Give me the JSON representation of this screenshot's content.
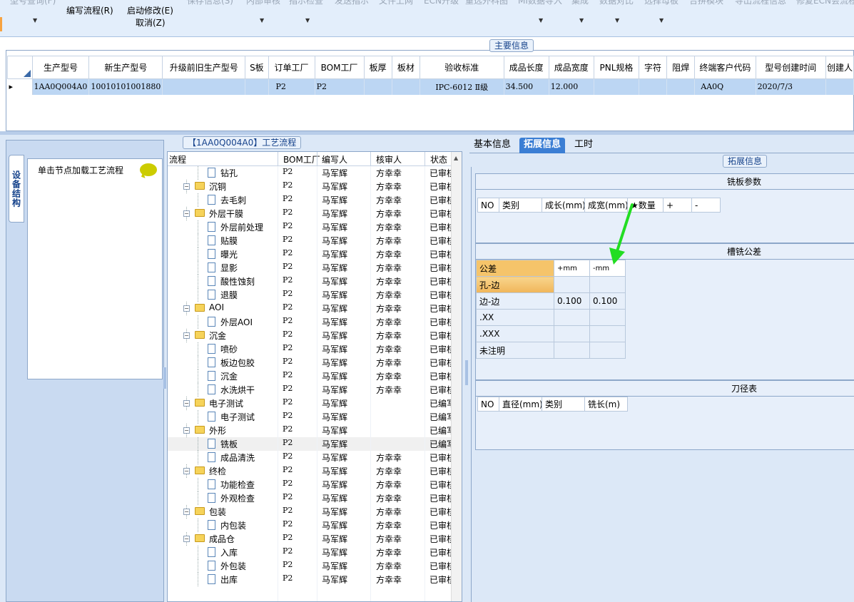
{
  "toolbar": {
    "top_row": [
      "型号查询(F)",
      "保存信息(S)",
      "内部审核",
      "指示检查",
      "发送指示",
      "文件上网",
      "ECN升级",
      "重选外科图",
      "MI数据导入",
      "集成",
      "数据对比",
      "选择母板",
      "合拼模块",
      "导出流程信息",
      "修复ECN会流程"
    ],
    "edit_flow": "编写流程(R)",
    "start_modify": "启动修改(E)",
    "cancel": "取消(Z)"
  },
  "main_group": {
    "title": "主要信息",
    "columns": [
      "生产型号",
      "新生产型号",
      "升级前旧生产型号",
      "S板",
      "订单工厂",
      "BOM工厂",
      "板厚",
      "板材",
      "验收标准",
      "成品长度",
      "成品宽度",
      "PNL规格",
      "字符",
      "阻焊",
      "终端客户代码",
      "型号创建时间",
      "创建人"
    ],
    "row": [
      "1AA0Q004A0",
      "10010101001880",
      "",
      "",
      "P2",
      "P2",
      "",
      "",
      "IPC-6012 Ⅱ级",
      "34.500",
      "12.000",
      "",
      "",
      "",
      "AA0Q",
      "2020/7/3",
      ""
    ]
  },
  "left_panel": {
    "vertical_tab": "设备结构",
    "hint": "单击节点加载工艺流程"
  },
  "flow_panel": {
    "title": "【1AA0Q004A0】工艺流程",
    "columns": [
      "流程",
      "BOM工厂",
      "编写人",
      "核审人",
      "状态"
    ],
    "rows": [
      {
        "name": "钻孔",
        "level": 2,
        "bom": "P2",
        "writer": "马军辉",
        "reviewer": "方幸幸",
        "status": "已审核"
      },
      {
        "name": "沉铜",
        "level": 1,
        "bom": "P2",
        "writer": "马军辉",
        "reviewer": "方幸幸",
        "status": "已审核"
      },
      {
        "name": "去毛刺",
        "level": 2,
        "bom": "P2",
        "writer": "马军辉",
        "reviewer": "方幸幸",
        "status": "已审核"
      },
      {
        "name": "外层干膜",
        "level": 1,
        "bom": "P2",
        "writer": "马军辉",
        "reviewer": "方幸幸",
        "status": "已审核"
      },
      {
        "name": "外层前处理",
        "level": 2,
        "bom": "P2",
        "writer": "马军辉",
        "reviewer": "方幸幸",
        "status": "已审核"
      },
      {
        "name": "贴膜",
        "level": 2,
        "bom": "P2",
        "writer": "马军辉",
        "reviewer": "方幸幸",
        "status": "已审核"
      },
      {
        "name": "曝光",
        "level": 2,
        "bom": "P2",
        "writer": "马军辉",
        "reviewer": "方幸幸",
        "status": "已审核"
      },
      {
        "name": "显影",
        "level": 2,
        "bom": "P2",
        "writer": "马军辉",
        "reviewer": "方幸幸",
        "status": "已审核"
      },
      {
        "name": "酸性蚀刻",
        "level": 2,
        "bom": "P2",
        "writer": "马军辉",
        "reviewer": "方幸幸",
        "status": "已审核"
      },
      {
        "name": "退膜",
        "level": 2,
        "bom": "P2",
        "writer": "马军辉",
        "reviewer": "方幸幸",
        "status": "已审核"
      },
      {
        "name": "AOI",
        "level": 1,
        "bom": "P2",
        "writer": "马军辉",
        "reviewer": "方幸幸",
        "status": "已审核"
      },
      {
        "name": "外层AOI",
        "level": 2,
        "bom": "P2",
        "writer": "马军辉",
        "reviewer": "方幸幸",
        "status": "已审核"
      },
      {
        "name": "沉金",
        "level": 1,
        "bom": "P2",
        "writer": "马军辉",
        "reviewer": "方幸幸",
        "status": "已审核"
      },
      {
        "name": "喷砂",
        "level": 2,
        "bom": "P2",
        "writer": "马军辉",
        "reviewer": "方幸幸",
        "status": "已审核"
      },
      {
        "name": "板边包胶",
        "level": 2,
        "bom": "P2",
        "writer": "马军辉",
        "reviewer": "方幸幸",
        "status": "已审核"
      },
      {
        "name": "沉金",
        "level": 2,
        "bom": "P2",
        "writer": "马军辉",
        "reviewer": "方幸幸",
        "status": "已审核"
      },
      {
        "name": "水洗烘干",
        "level": 2,
        "bom": "P2",
        "writer": "马军辉",
        "reviewer": "方幸幸",
        "status": "已审核"
      },
      {
        "name": "电子测试",
        "level": 1,
        "bom": "P2",
        "writer": "马军辉",
        "reviewer": "",
        "status": "已编写"
      },
      {
        "name": "电子测试",
        "level": 2,
        "bom": "P2",
        "writer": "马军辉",
        "reviewer": "",
        "status": "已编写"
      },
      {
        "name": "外形",
        "level": 1,
        "bom": "P2",
        "writer": "马军辉",
        "reviewer": "",
        "status": "已编写"
      },
      {
        "name": "铣板",
        "level": 2,
        "bom": "P2",
        "writer": "马军辉",
        "reviewer": "",
        "status": "已编写",
        "selected": true
      },
      {
        "name": "成品清洗",
        "level": 2,
        "bom": "P2",
        "writer": "马军辉",
        "reviewer": "方幸幸",
        "status": "已审核"
      },
      {
        "name": "终检",
        "level": 1,
        "bom": "P2",
        "writer": "马军辉",
        "reviewer": "方幸幸",
        "status": "已审核"
      },
      {
        "name": "功能检查",
        "level": 2,
        "bom": "P2",
        "writer": "马军辉",
        "reviewer": "方幸幸",
        "status": "已审核"
      },
      {
        "name": "外观检查",
        "level": 2,
        "bom": "P2",
        "writer": "马军辉",
        "reviewer": "方幸幸",
        "status": "已审核"
      },
      {
        "name": "包装",
        "level": 1,
        "bom": "P2",
        "writer": "马军辉",
        "reviewer": "方幸幸",
        "status": "已审核"
      },
      {
        "name": "内包装",
        "level": 2,
        "bom": "P2",
        "writer": "马军辉",
        "reviewer": "方幸幸",
        "status": "已审核"
      },
      {
        "name": "成品仓",
        "level": 1,
        "bom": "P2",
        "writer": "马军辉",
        "reviewer": "方幸幸",
        "status": "已审核"
      },
      {
        "name": "入库",
        "level": 2,
        "bom": "P2",
        "writer": "马军辉",
        "reviewer": "方幸幸",
        "status": "已审核"
      },
      {
        "name": "外包装",
        "level": 2,
        "bom": "P2",
        "writer": "马军辉",
        "reviewer": "方幸幸",
        "status": "已审核"
      },
      {
        "name": "出库",
        "level": 2,
        "bom": "P2",
        "writer": "马军辉",
        "reviewer": "方幸幸",
        "status": "已审核"
      }
    ]
  },
  "right_panel": {
    "tabs": [
      "基本信息",
      "拓展信息",
      "工时"
    ],
    "active_tab": 1,
    "group_title": "拓展信息",
    "plate_params": {
      "title": "铣板参数",
      "columns": [
        "NO",
        "类别",
        "成长(mm)",
        "成宽(mm)",
        "★数量",
        "+",
        "-"
      ]
    },
    "groove_tolerance": {
      "title": "槽铣公差",
      "columns": [
        "公差",
        "+mm",
        "-mm"
      ],
      "rows": [
        [
          "孔-边",
          "",
          ""
        ],
        [
          "边-边",
          "0.100",
          "0.100"
        ],
        [
          ".XX",
          "",
          ""
        ],
        [
          ".XXX",
          "",
          ""
        ],
        [
          "未注明",
          "",
          ""
        ]
      ]
    },
    "tool_table": {
      "title": "刀径表",
      "columns": [
        "NO",
        "直径(mm)",
        "类别",
        "铣长(m)"
      ]
    }
  },
  "colors": {
    "selected_row": "#bcd6f3",
    "active_tab": "#3b7ed4",
    "annotation_arrow": "#22dd22",
    "highlight_header": "#f5c46a"
  }
}
